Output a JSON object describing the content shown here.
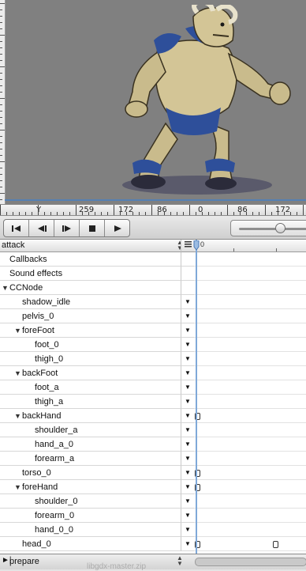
{
  "ruler": {
    "y_label": "Y",
    "ticks": [
      "259",
      "172",
      "86",
      "0",
      "86",
      "172"
    ]
  },
  "timeline": {
    "sequence_name": "attack",
    "start_time": "0",
    "rows": [
      {
        "label": "Callbacks",
        "indent": 0,
        "expander": "none",
        "has_menu": false,
        "keyframes": []
      },
      {
        "label": "Sound effects",
        "indent": 0,
        "expander": "none",
        "has_menu": false,
        "keyframes": []
      },
      {
        "label": "CCNode",
        "indent": 0,
        "expander": "open",
        "has_menu": false,
        "keyframes": []
      },
      {
        "label": "shadow_idle",
        "indent": 2,
        "expander": "none",
        "has_menu": true,
        "keyframes": []
      },
      {
        "label": "pelvis_0",
        "indent": 2,
        "expander": "none",
        "has_menu": true,
        "keyframes": []
      },
      {
        "label": "foreFoot",
        "indent": 1,
        "expander": "open",
        "has_menu": true,
        "keyframes": []
      },
      {
        "label": "foot_0",
        "indent": 3,
        "expander": "none",
        "has_menu": true,
        "keyframes": []
      },
      {
        "label": "thigh_0",
        "indent": 3,
        "expander": "none",
        "has_menu": true,
        "keyframes": []
      },
      {
        "label": "backFoot",
        "indent": 1,
        "expander": "open",
        "has_menu": true,
        "keyframes": []
      },
      {
        "label": "foot_a",
        "indent": 3,
        "expander": "none",
        "has_menu": true,
        "keyframes": []
      },
      {
        "label": "thigh_a",
        "indent": 3,
        "expander": "none",
        "has_menu": true,
        "keyframes": []
      },
      {
        "label": "backHand",
        "indent": 1,
        "expander": "open",
        "has_menu": true,
        "keyframes": [
          0
        ]
      },
      {
        "label": "shoulder_a",
        "indent": 3,
        "expander": "none",
        "has_menu": true,
        "keyframes": []
      },
      {
        "label": "hand_a_0",
        "indent": 3,
        "expander": "none",
        "has_menu": true,
        "keyframes": []
      },
      {
        "label": "forearm_a",
        "indent": 3,
        "expander": "none",
        "has_menu": true,
        "keyframes": []
      },
      {
        "label": "torso_0",
        "indent": 2,
        "expander": "none",
        "has_menu": true,
        "keyframes": [
          0
        ]
      },
      {
        "label": "foreHand",
        "indent": 1,
        "expander": "open",
        "has_menu": true,
        "keyframes": [
          0
        ]
      },
      {
        "label": "shoulder_0",
        "indent": 3,
        "expander": "none",
        "has_menu": true,
        "keyframes": []
      },
      {
        "label": "forearm_0",
        "indent": 3,
        "expander": "none",
        "has_menu": true,
        "keyframes": []
      },
      {
        "label": "hand_0_0",
        "indent": 3,
        "expander": "none",
        "has_menu": true,
        "keyframes": []
      },
      {
        "label": "head_0",
        "indent": 2,
        "expander": "none",
        "has_menu": true,
        "keyframes": [
          0,
          1
        ]
      }
    ]
  },
  "bottom": {
    "chained_sequence": "prepare",
    "background_text": "libgdx-master.zip"
  },
  "icons": [
    "go-to-start-icon",
    "step-back-icon",
    "step-forward-icon",
    "stop-icon",
    "play-icon",
    "timeline-zoom-slider"
  ],
  "colors": {
    "canvas_bg": "#808080",
    "playhead": "#7fa8d8",
    "stage_border": "#4a7fbf"
  }
}
